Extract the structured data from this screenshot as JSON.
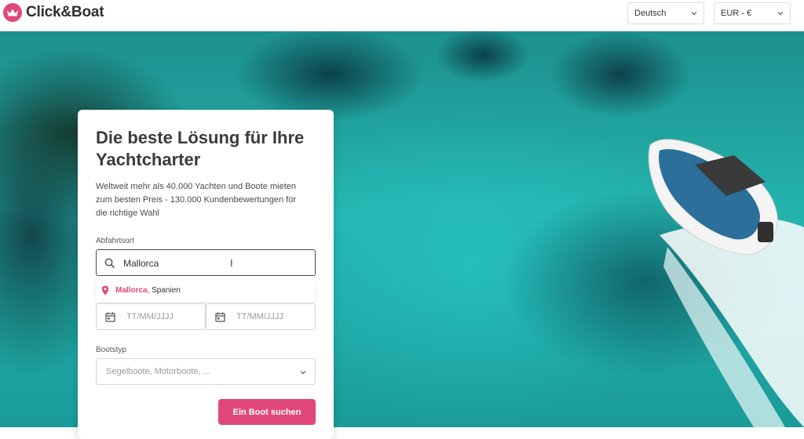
{
  "header": {
    "brand_name": "Click&Boat",
    "language": "Deutsch",
    "currency": "EUR - €",
    "accent_color": "#e2477b"
  },
  "card": {
    "title": "Die beste Lösung für Ihre Yachtcharter",
    "description": "Weltweit mehr als 40.000 Yachten und Boote mieten zum besten Preis - 130.000 Kundenbewertungen für die richtige Wahl",
    "departure": {
      "label": "Abfahrtsort",
      "value": "Mallorca",
      "suggestion": {
        "match": "Mallorca",
        "rest": ", Spanien"
      }
    },
    "dates": {
      "start_placeholder": "TT/MM/JJJJ",
      "end_placeholder": "TT/MM/JJJJ"
    },
    "boat_type": {
      "label": "Bootstyp",
      "placeholder": "Segelboote, Motorboote, ..."
    },
    "search_button": "Ein Boot suchen"
  }
}
